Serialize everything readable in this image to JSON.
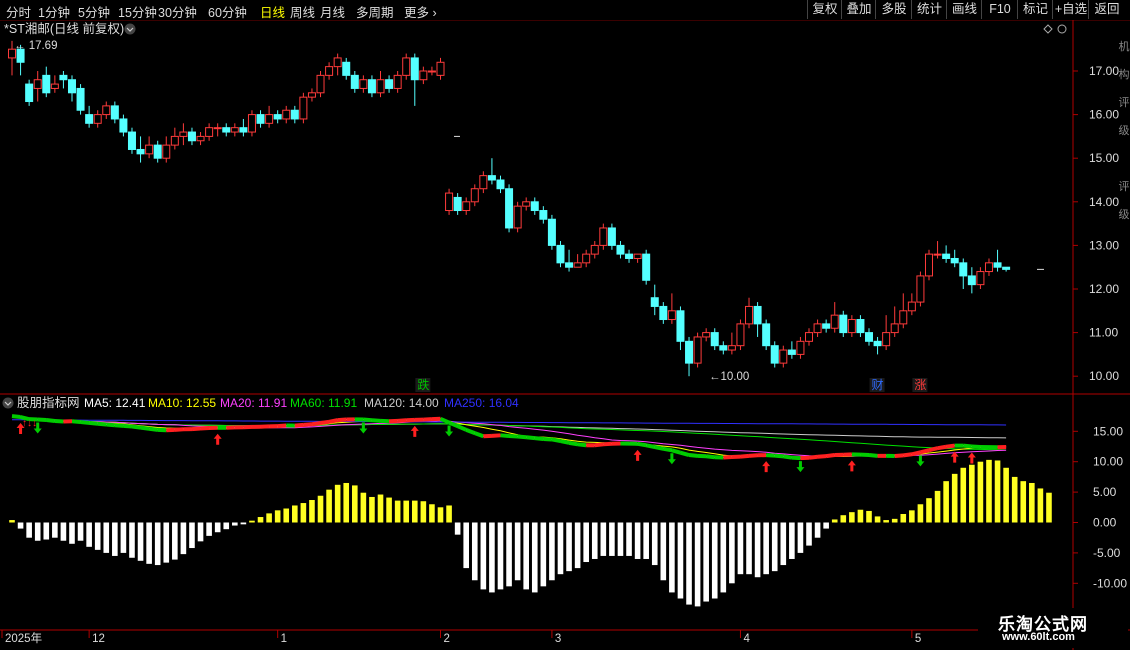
{
  "toolbar": {
    "periods": [
      "分时",
      "1分钟",
      "5分钟",
      "15分钟",
      "30分钟",
      "60分钟",
      "日线",
      "周线",
      "月线",
      "多周期",
      "更多"
    ],
    "active_period": "日线",
    "right_buttons": [
      "复权",
      "叠加",
      "多股",
      "统计",
      "画线",
      "F10",
      "标记",
      "+自选",
      "返回"
    ]
  },
  "main_panel": {
    "title": "*ST湘邮(日线 前复权)",
    "high_label": "17.69",
    "low_label": "10.00",
    "event_labels": [
      {
        "text": "跌",
        "color": "#00c000",
        "date_index": 48
      },
      {
        "text": "财",
        "color": "#2f6bff",
        "date_index": 101
      },
      {
        "text": "涨",
        "color": "#ff3b3b",
        "date_index": 106
      }
    ],
    "y_ticks": [
      "17.00",
      "16.00",
      "15.00",
      "14.00",
      "13.00",
      "12.00",
      "11.00",
      "10.00"
    ],
    "side_text": "机构评级 评级"
  },
  "sub_panel": {
    "name": "股朋指标网",
    "tag_text": "↑↓↓​",
    "legend": [
      {
        "label": "MA5: 12.41",
        "color": "#ffffff"
      },
      {
        "label": "MA10: 12.55",
        "color": "#ffff00"
      },
      {
        "label": "MA20: 11.91",
        "color": "#ff40ff"
      },
      {
        "label": "MA60: 11.91",
        "color": "#00e000"
      },
      {
        "label": "MA120: 14.00",
        "color": "#cccccc"
      },
      {
        "label": "MA250: 16.04",
        "color": "#3030ff"
      }
    ],
    "y_ticks": [
      "15.00",
      "10.00",
      "5.00",
      "0.00",
      "-5.00",
      "-10.00"
    ]
  },
  "date_axis": [
    {
      "label": "2025年",
      "date_index": 0
    },
    {
      "label": "12",
      "date_index": 9
    },
    {
      "label": "1",
      "date_index": 31
    },
    {
      "label": "2",
      "date_index": 50
    },
    {
      "label": "3",
      "date_index": 63
    },
    {
      "label": "4",
      "date_index": 85
    },
    {
      "label": "5",
      "date_index": 105
    }
  ],
  "watermark": {
    "line1": "乐淘公式网",
    "line2": "www.60lt.com"
  },
  "colors": {
    "up": "#ff3b3b",
    "down": "#54ffff",
    "axis": "#b00000",
    "grid": "#5a0000",
    "bar_pos": "#ffff22",
    "bar_neg": "#ffffff"
  },
  "chart_data": {
    "type": "candlestick",
    "title": "*ST湘邮(日线 前复权)",
    "ylim": [
      9.8,
      18.1
    ],
    "candles": [
      [
        17.3,
        17.5,
        16.9,
        17.69
      ],
      [
        17.5,
        17.2,
        16.9,
        17.6
      ],
      [
        16.7,
        16.3,
        16.2,
        16.8
      ],
      [
        16.6,
        16.8,
        16.3,
        17.0
      ],
      [
        16.9,
        16.5,
        16.4,
        17.1
      ],
      [
        16.6,
        16.7,
        16.5,
        16.9
      ],
      [
        16.9,
        16.8,
        16.6,
        17.0
      ],
      [
        16.8,
        16.5,
        16.3,
        16.9
      ],
      [
        16.6,
        16.1,
        16.0,
        16.7
      ],
      [
        16.0,
        15.8,
        15.7,
        16.2
      ],
      [
        15.8,
        16.0,
        15.7,
        16.1
      ],
      [
        16.0,
        16.2,
        15.9,
        16.3
      ],
      [
        16.2,
        15.9,
        15.8,
        16.3
      ],
      [
        15.9,
        15.6,
        15.5,
        16.0
      ],
      [
        15.6,
        15.2,
        15.1,
        15.7
      ],
      [
        15.2,
        15.1,
        14.9,
        15.5
      ],
      [
        15.1,
        15.3,
        15.0,
        15.5
      ],
      [
        15.3,
        15.0,
        14.9,
        15.4
      ],
      [
        15.0,
        15.3,
        14.9,
        15.5
      ],
      [
        15.3,
        15.5,
        15.2,
        15.7
      ],
      [
        15.5,
        15.6,
        15.3,
        15.8
      ],
      [
        15.6,
        15.4,
        15.3,
        15.7
      ],
      [
        15.4,
        15.5,
        15.3,
        15.6
      ],
      [
        15.5,
        15.7,
        15.4,
        15.8
      ],
      [
        15.7,
        15.7,
        15.5,
        15.8
      ],
      [
        15.7,
        15.6,
        15.5,
        15.8
      ],
      [
        15.6,
        15.7,
        15.5,
        15.8
      ],
      [
        15.7,
        15.6,
        15.5,
        15.9
      ],
      [
        15.6,
        16.0,
        15.5,
        16.1
      ],
      [
        16.0,
        15.8,
        15.7,
        16.1
      ],
      [
        15.8,
        16.0,
        15.7,
        16.2
      ],
      [
        16.0,
        15.9,
        15.8,
        16.1
      ],
      [
        15.9,
        16.1,
        15.8,
        16.2
      ],
      [
        16.1,
        15.9,
        15.8,
        16.2
      ],
      [
        15.9,
        16.4,
        15.8,
        16.5
      ],
      [
        16.4,
        16.5,
        16.3,
        16.6
      ],
      [
        16.5,
        16.9,
        16.4,
        17.0
      ],
      [
        16.9,
        17.1,
        16.8,
        17.2
      ],
      [
        17.1,
        17.3,
        16.9,
        17.4
      ],
      [
        17.2,
        16.9,
        16.8,
        17.3
      ],
      [
        16.9,
        16.6,
        16.5,
        17.0
      ],
      [
        16.6,
        16.8,
        16.5,
        16.9
      ],
      [
        16.8,
        16.5,
        16.4,
        16.9
      ],
      [
        16.5,
        16.8,
        16.4,
        17.0
      ],
      [
        16.8,
        16.6,
        16.5,
        16.9
      ],
      [
        16.6,
        16.9,
        16.5,
        17.0
      ],
      [
        16.9,
        17.3,
        16.8,
        17.4
      ],
      [
        17.3,
        16.8,
        16.2,
        17.4
      ],
      [
        16.8,
        17.0,
        16.7,
        17.1
      ],
      [
        17.0,
        17.0,
        16.9,
        17.1
      ],
      [
        16.9,
        17.2,
        16.8,
        17.3
      ],
      [
        13.8,
        14.2,
        13.7,
        14.3
      ],
      [
        14.1,
        13.8,
        13.7,
        14.2
      ],
      [
        13.8,
        14.0,
        13.7,
        14.1
      ],
      [
        14.0,
        14.3,
        13.9,
        14.4
      ],
      [
        14.3,
        14.6,
        14.2,
        14.7
      ],
      [
        14.6,
        14.5,
        14.4,
        15.0
      ],
      [
        14.5,
        14.3,
        14.2,
        14.6
      ],
      [
        14.3,
        13.4,
        13.3,
        14.4
      ],
      [
        13.4,
        13.9,
        13.3,
        14.0
      ],
      [
        13.9,
        14.0,
        13.8,
        14.1
      ],
      [
        14.0,
        13.8,
        13.7,
        14.1
      ],
      [
        13.8,
        13.6,
        13.5,
        13.9
      ],
      [
        13.6,
        13.0,
        12.9,
        13.7
      ],
      [
        13.0,
        12.6,
        12.5,
        13.1
      ],
      [
        12.6,
        12.5,
        12.4,
        12.9
      ],
      [
        12.5,
        12.6,
        12.5,
        12.8
      ],
      [
        12.6,
        12.8,
        12.5,
        12.9
      ],
      [
        12.8,
        13.0,
        12.7,
        13.1
      ],
      [
        13.0,
        13.4,
        12.9,
        13.5
      ],
      [
        13.4,
        13.0,
        12.9,
        13.5
      ],
      [
        13.0,
        12.8,
        12.7,
        13.1
      ],
      [
        12.8,
        12.7,
        12.6,
        12.9
      ],
      [
        12.7,
        12.8,
        12.6,
        12.8
      ],
      [
        12.8,
        12.2,
        12.1,
        12.9
      ],
      [
        11.8,
        11.6,
        11.4,
        12.1
      ],
      [
        11.6,
        11.3,
        11.2,
        11.7
      ],
      [
        11.3,
        11.5,
        11.2,
        11.9
      ],
      [
        11.5,
        10.8,
        10.6,
        11.6
      ],
      [
        10.8,
        10.3,
        10.0,
        10.9
      ],
      [
        10.3,
        10.9,
        10.2,
        11.0
      ],
      [
        10.9,
        11.0,
        10.8,
        11.1
      ],
      [
        11.0,
        10.7,
        10.6,
        11.1
      ],
      [
        10.7,
        10.6,
        10.5,
        10.8
      ],
      [
        10.6,
        10.7,
        10.5,
        11.0
      ],
      [
        10.7,
        11.2,
        10.6,
        11.3
      ],
      [
        11.2,
        11.6,
        11.1,
        11.8
      ],
      [
        11.6,
        11.2,
        10.9,
        11.7
      ],
      [
        11.2,
        10.7,
        10.6,
        11.3
      ],
      [
        10.7,
        10.3,
        10.2,
        10.8
      ],
      [
        10.3,
        10.6,
        10.2,
        10.7
      ],
      [
        10.6,
        10.5,
        10.4,
        10.8
      ],
      [
        10.5,
        10.8,
        10.4,
        10.9
      ],
      [
        10.8,
        11.0,
        10.7,
        11.1
      ],
      [
        11.0,
        11.2,
        10.9,
        11.3
      ],
      [
        11.2,
        11.1,
        11.0,
        11.3
      ],
      [
        11.1,
        11.4,
        11.0,
        11.7
      ],
      [
        11.4,
        11.0,
        10.9,
        11.5
      ],
      [
        11.0,
        11.3,
        10.9,
        11.4
      ],
      [
        11.3,
        11.0,
        10.9,
        11.4
      ],
      [
        11.0,
        10.8,
        10.7,
        11.1
      ],
      [
        10.8,
        10.7,
        10.5,
        10.9
      ],
      [
        10.7,
        11.0,
        10.6,
        11.4
      ],
      [
        11.0,
        11.2,
        10.9,
        11.6
      ],
      [
        11.2,
        11.5,
        11.1,
        11.9
      ],
      [
        11.5,
        11.7,
        11.4,
        11.9
      ],
      [
        11.7,
        12.3,
        11.6,
        12.4
      ],
      [
        12.3,
        12.8,
        12.2,
        12.9
      ],
      [
        12.8,
        12.8,
        12.7,
        13.1
      ],
      [
        12.8,
        12.7,
        12.6,
        13.0
      ],
      [
        12.7,
        12.6,
        12.5,
        12.9
      ],
      [
        12.6,
        12.3,
        12.0,
        12.7
      ],
      [
        12.3,
        12.1,
        11.9,
        12.5
      ],
      [
        12.1,
        12.4,
        12.0,
        12.5
      ],
      [
        12.4,
        12.6,
        12.3,
        12.7
      ],
      [
        12.6,
        12.5,
        12.4,
        12.9
      ],
      [
        12.5,
        12.45,
        12.4,
        12.5
      ]
    ],
    "ma_lines": [
      {
        "name": "MA5",
        "color": "#ffffff",
        "last": 12.41
      },
      {
        "name": "MA10",
        "color": "#ffff00",
        "last": 12.55
      },
      {
        "name": "MA20",
        "color": "#ff40ff",
        "last": 11.91
      },
      {
        "name": "MA60",
        "color": "#00e000",
        "last": 11.91
      },
      {
        "name": "MA120",
        "color": "#cccccc",
        "last": 14.0
      },
      {
        "name": "MA250",
        "color": "#3030ff",
        "last": 16.04
      }
    ],
    "sub_ylim": [
      -11.6,
      18.6
    ],
    "histogram": [
      0.4,
      -1.0,
      -2.5,
      -3.0,
      -2.8,
      -2.5,
      -3.0,
      -3.5,
      -3.0,
      -4.0,
      -4.5,
      -5.0,
      -5.5,
      -5.0,
      -5.8,
      -6.3,
      -6.8,
      -7.0,
      -6.6,
      -6.1,
      -5.2,
      -4.2,
      -3.1,
      -2.2,
      -1.6,
      -1.1,
      -0.5,
      -0.3,
      0.3,
      0.9,
      1.5,
      2.0,
      2.3,
      2.8,
      3.2,
      3.7,
      4.4,
      5.4,
      6.2,
      6.5,
      6.1,
      4.9,
      4.2,
      4.6,
      4.1,
      3.6,
      3.6,
      3.6,
      3.5,
      3.0,
      2.5,
      2.8,
      -2.0,
      -7.5,
      -9.5,
      -11.0,
      -11.5,
      -11.0,
      -10.5,
      -9.5,
      -11.0,
      -11.5,
      -10.5,
      -9.5,
      -8.5,
      -8.0,
      -7.5,
      -6.5,
      -6.0,
      -5.5,
      -5.5,
      -5.5,
      -5.5,
      -6.0,
      -6.0,
      -7.0,
      -9.5,
      -11.5,
      -12.5,
      -13.5,
      -13.8,
      -13.0,
      -12.5,
      -11.5,
      -10.0,
      -8.5,
      -8.5,
      -9.0,
      -8.5,
      -8.0,
      -7.0,
      -6.0,
      -5.0,
      -3.8,
      -2.5,
      -1.0,
      0.5,
      1.2,
      1.7,
      2.1,
      1.9,
      1.0,
      0.4,
      0.6,
      1.4,
      2.0,
      3.0,
      4.0,
      5.2,
      6.8,
      8.0,
      9.0,
      9.5,
      10.0,
      10.3,
      10.2,
      9.0,
      7.5,
      6.8,
      6.5,
      5.6,
      4.9
    ],
    "signals": [
      {
        "i": 1,
        "dir": "up"
      },
      {
        "i": 3,
        "dir": "down"
      },
      {
        "i": 24,
        "dir": "up"
      },
      {
        "i": 41,
        "dir": "down"
      },
      {
        "i": 47,
        "dir": "up"
      },
      {
        "i": 51,
        "dir": "down"
      },
      {
        "i": 73,
        "dir": "up"
      },
      {
        "i": 77,
        "dir": "down"
      },
      {
        "i": 88,
        "dir": "up"
      },
      {
        "i": 92,
        "dir": "down"
      },
      {
        "i": 98,
        "dir": "up"
      },
      {
        "i": 106,
        "dir": "down"
      },
      {
        "i": 110,
        "dir": "up"
      },
      {
        "i": 112,
        "dir": "up"
      },
      {
        "i": 120,
        "dir": "down"
      }
    ]
  }
}
